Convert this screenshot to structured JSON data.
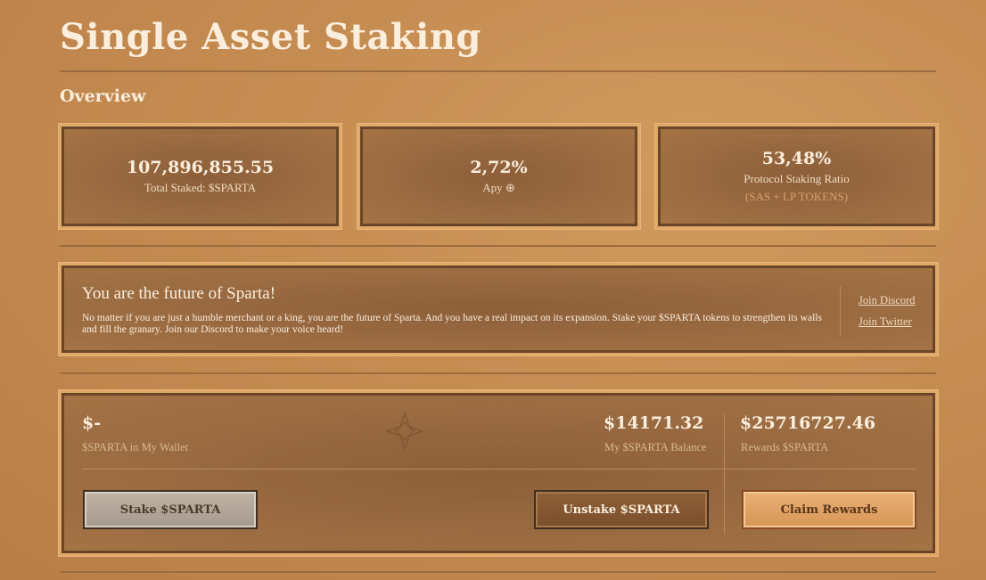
{
  "page": {
    "title": "Single Asset Staking",
    "overview_heading": "Overview"
  },
  "stats": [
    {
      "value": "107,896,855.55",
      "label": "Total Staked: $SPARTA"
    },
    {
      "value": "2,72%",
      "label": "Apy ⊕"
    },
    {
      "value": "53,48%",
      "label": "Protocol Staking Ratio",
      "sub": "(SAS + LP TOKENS)"
    }
  ],
  "info": {
    "heading": "You are the future of Sparta!",
    "body": "No matter if you are just a humble merchant or a king, you are the future of Sparta. And you have a real impact on its expansion. Stake your $SPARTA tokens to strengthen its walls and fill the granary. Join our Discord to make your voice heard!",
    "links": [
      "Join Discord",
      "Join Twitter"
    ]
  },
  "staking": {
    "wallet_value": "$-",
    "wallet_label": "$SPARTA in My Wallet",
    "balance_value": "$14171.32",
    "balance_label": "My $SPARTA Balance",
    "rewards_value": "$25716727.46",
    "rewards_label": "Rewards $SPARTA",
    "stake_button": "Stake $SPARTA",
    "unstake_button": "Unstake $SPARTA",
    "claim_button": "Claim Rewards"
  },
  "colors": {
    "background": "#c58c52",
    "panel": "#9a6a41",
    "panel_border": "#e0a968",
    "text": "#fbeedd",
    "accent_button": "#d69556"
  }
}
